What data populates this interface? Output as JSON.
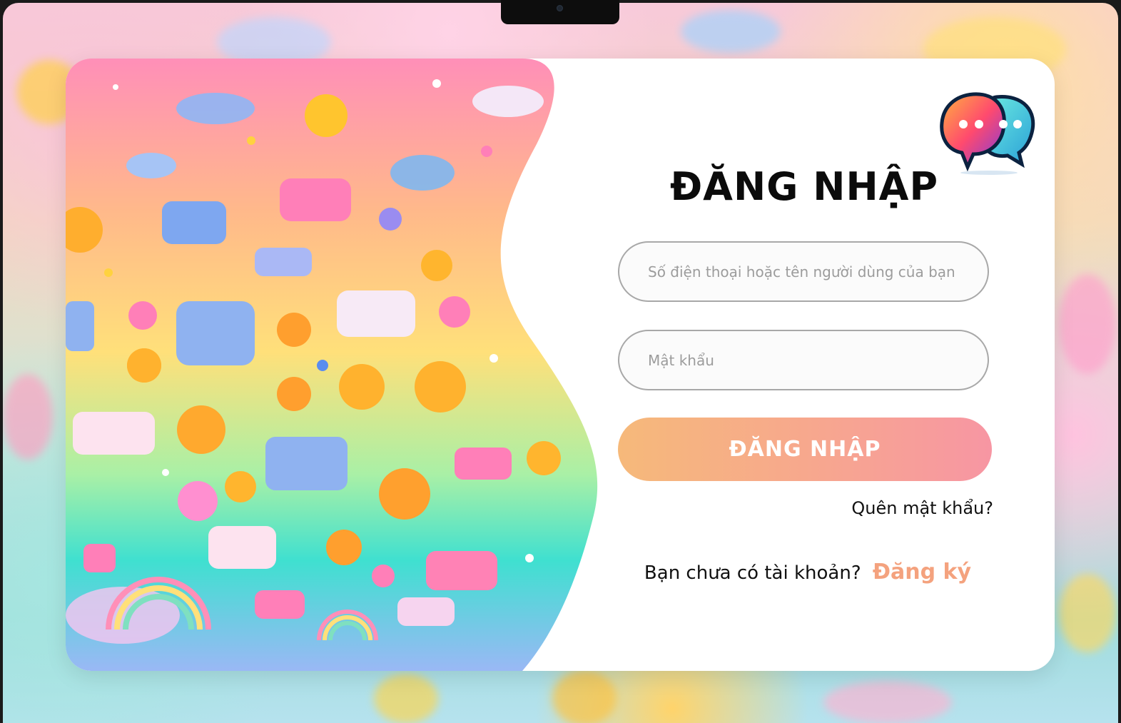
{
  "login": {
    "title": "ĐĂNG NHẬP",
    "phone_placeholder": "Số điện thoại hoặc tên người dùng của bạn",
    "password_placeholder": "Mật khẩu",
    "login_button": "ĐĂNG NHẬP",
    "forgot_password": "Quên mật khẩu?",
    "no_account_text": "Bạn chưa có tài khoản?",
    "signup_link": "Đăng ký"
  },
  "logo": {
    "icon": "chat-bubbles-logo"
  },
  "colors": {
    "accent_orange": "#f6b97a",
    "accent_pink": "#f796a3",
    "signup_link": "#f4a27e",
    "title": "#0b0b0b"
  }
}
